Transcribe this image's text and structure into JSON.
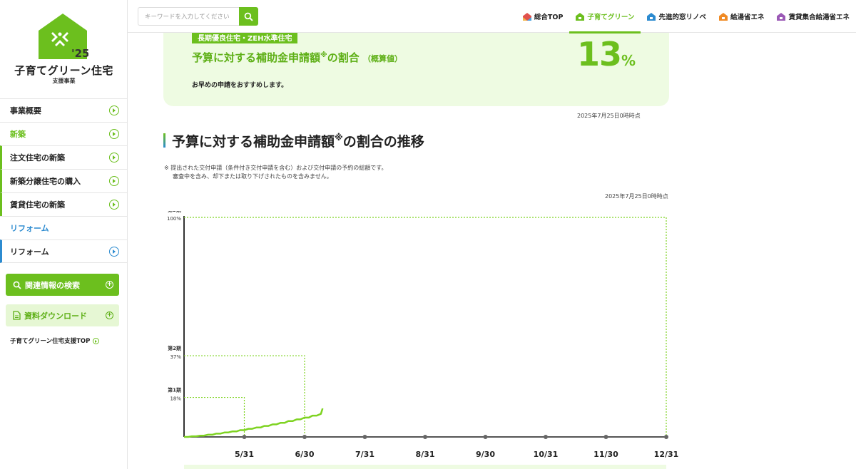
{
  "sidebar": {
    "logo_title": "子育てグリーン住宅",
    "logo_sub": "支援事業",
    "logo_year": "'25",
    "items": [
      {
        "label": "事業概要"
      },
      {
        "label": "新築"
      },
      {
        "label": "注文住宅の新築"
      },
      {
        "label": "新築分譲住宅の購入"
      },
      {
        "label": "賃貸住宅の新築"
      },
      {
        "label": "リフォーム"
      },
      {
        "label": "リフォーム"
      }
    ],
    "search_button": "関連情報の検索",
    "download_button": "資料ダウンロード",
    "top_link": "子育てグリーン住宅支援TOP"
  },
  "header": {
    "search_placeholder": "キーワードを入力してください",
    "tabs": [
      {
        "label": "総合TOP",
        "color": "#e0524d"
      },
      {
        "label": "子育てグリーン",
        "color": "#6cbf1e"
      },
      {
        "label": "先進的窓リノベ",
        "color": "#2c8bd0"
      },
      {
        "label": "給湯省エネ",
        "color": "#f08a24"
      },
      {
        "label": "賃貸集合給湯省エネ",
        "color": "#9b59b6"
      }
    ]
  },
  "panel": {
    "tag": "長期優良住宅・ZEH水準住宅",
    "title": "予算に対する補助金申請額",
    "title_mark": "※",
    "title_tail": "の割合",
    "title_note": "（概算値）",
    "note": "お早めの申請をおすすめします。",
    "percent": "13",
    "percent_unit": "%",
    "date": "2025年7月25日0時時点"
  },
  "section": {
    "title": "予算に対する補助金申請額",
    "title_mark": "※",
    "title_tail": "の割合の推移",
    "note1": "※ 提出された交付申請（条件付き交付申請を含む）および交付申請の予約の総額です。",
    "note2": "審査中を含み、却下または取り下げされたものを含みません。",
    "asof": "2025年7月25日0時時点"
  },
  "chart_data": {
    "type": "line",
    "x_ticks": [
      "5/31",
      "6/30",
      "7/31",
      "8/31",
      "9/30",
      "10/31",
      "11/30",
      "12/31"
    ],
    "periods": [
      {
        "name": "第1期",
        "value_label": "18%",
        "value": 18,
        "end": "5/31"
      },
      {
        "name": "第2期",
        "value_label": "37%",
        "value": 37,
        "end": "6/30"
      },
      {
        "name": "第3期",
        "value_label": "100%",
        "value": 100,
        "end": "12/31"
      }
    ],
    "series": [
      {
        "x": [
          0.0,
          0.07,
          0.13,
          0.2,
          0.27,
          0.33,
          0.4,
          0.47,
          0.53,
          0.6,
          0.67,
          0.73,
          0.8,
          0.87,
          0.93,
          1.0,
          1.07,
          1.13,
          1.2,
          1.27,
          1.33,
          1.4,
          1.47,
          1.53,
          1.6,
          1.67,
          1.73,
          1.8,
          1.87,
          1.93,
          2.0,
          2.07,
          2.13,
          2.2,
          2.27,
          2.3
        ],
        "y": [
          0.0,
          0.0,
          0.3,
          0.3,
          0.6,
          0.6,
          1.0,
          1.0,
          1.5,
          1.5,
          2.0,
          2.0,
          2.5,
          2.5,
          3.1,
          3.1,
          3.7,
          3.7,
          4.3,
          4.3,
          5.0,
          5.0,
          5.7,
          5.7,
          6.4,
          6.4,
          7.2,
          7.2,
          8.0,
          8.0,
          8.8,
          8.8,
          9.7,
          9.7,
          10.5,
          13.0
        ]
      }
    ],
    "ylim": [
      0,
      100
    ],
    "line_color": "#7ed321",
    "period_line_color": "#7ed321"
  }
}
